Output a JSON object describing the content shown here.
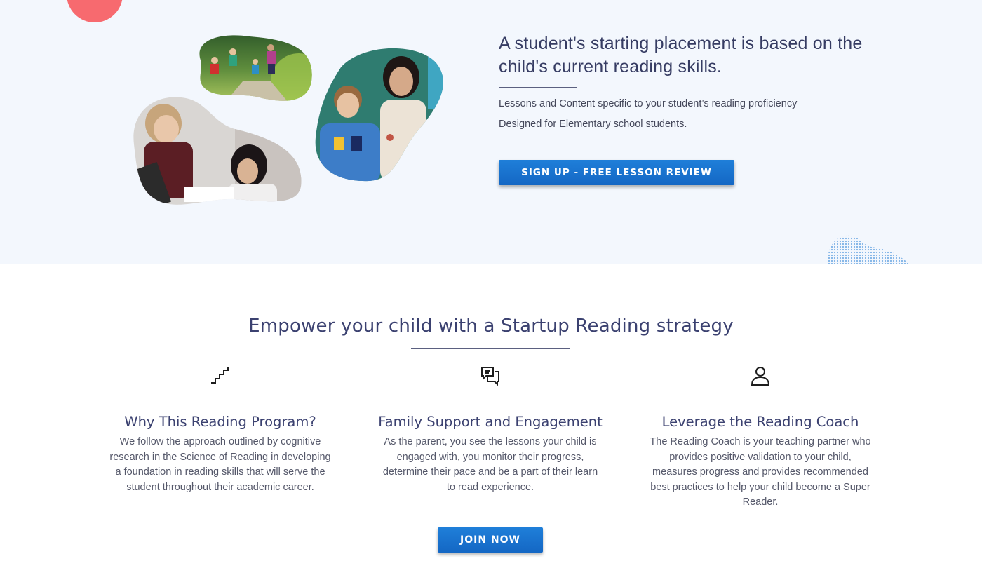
{
  "colors": {
    "hero_background": "#f3f7fd",
    "accent_blue": "#1a73d0",
    "heading_navy": "#363c63",
    "coral": "#f76a6f"
  },
  "hero": {
    "heading": "A student's starting placement is based on the child's current reading skills.",
    "lines": [
      "Lessons and Content specific to your student’s reading proficiency",
      "Designed for Elementary school students."
    ],
    "signup_button": "SIGN UP - FREE LESSON REVIEW",
    "photos": [
      {
        "icon": "children-running-photo"
      },
      {
        "icon": "tutor-with-student-photo"
      },
      {
        "icon": "two-students-photo"
      }
    ]
  },
  "features_section": {
    "title": "Empower your child with a Startup Reading strategy",
    "features": [
      {
        "icon": "stairs-icon",
        "title": "Why This Reading Program?",
        "text": "We follow the approach outlined by cognitive research in the Science of Reading in developing a foundation in reading skills that will serve the student throughout their academic career."
      },
      {
        "icon": "chat-bubbles-icon",
        "title": "Family Support and Engagement",
        "text": "As the parent, you see the lessons your child is engaged with, you monitor their progress, determine their pace and be a part of their learn to read experience."
      },
      {
        "icon": "person-icon",
        "title": "Leverage the Reading Coach",
        "text": "The Reading Coach is your teaching partner who provides positive validation to your child, measures progress and provides recommended best practices to help your child become a Super Reader."
      }
    ],
    "join_button": "JOIN NOW"
  }
}
